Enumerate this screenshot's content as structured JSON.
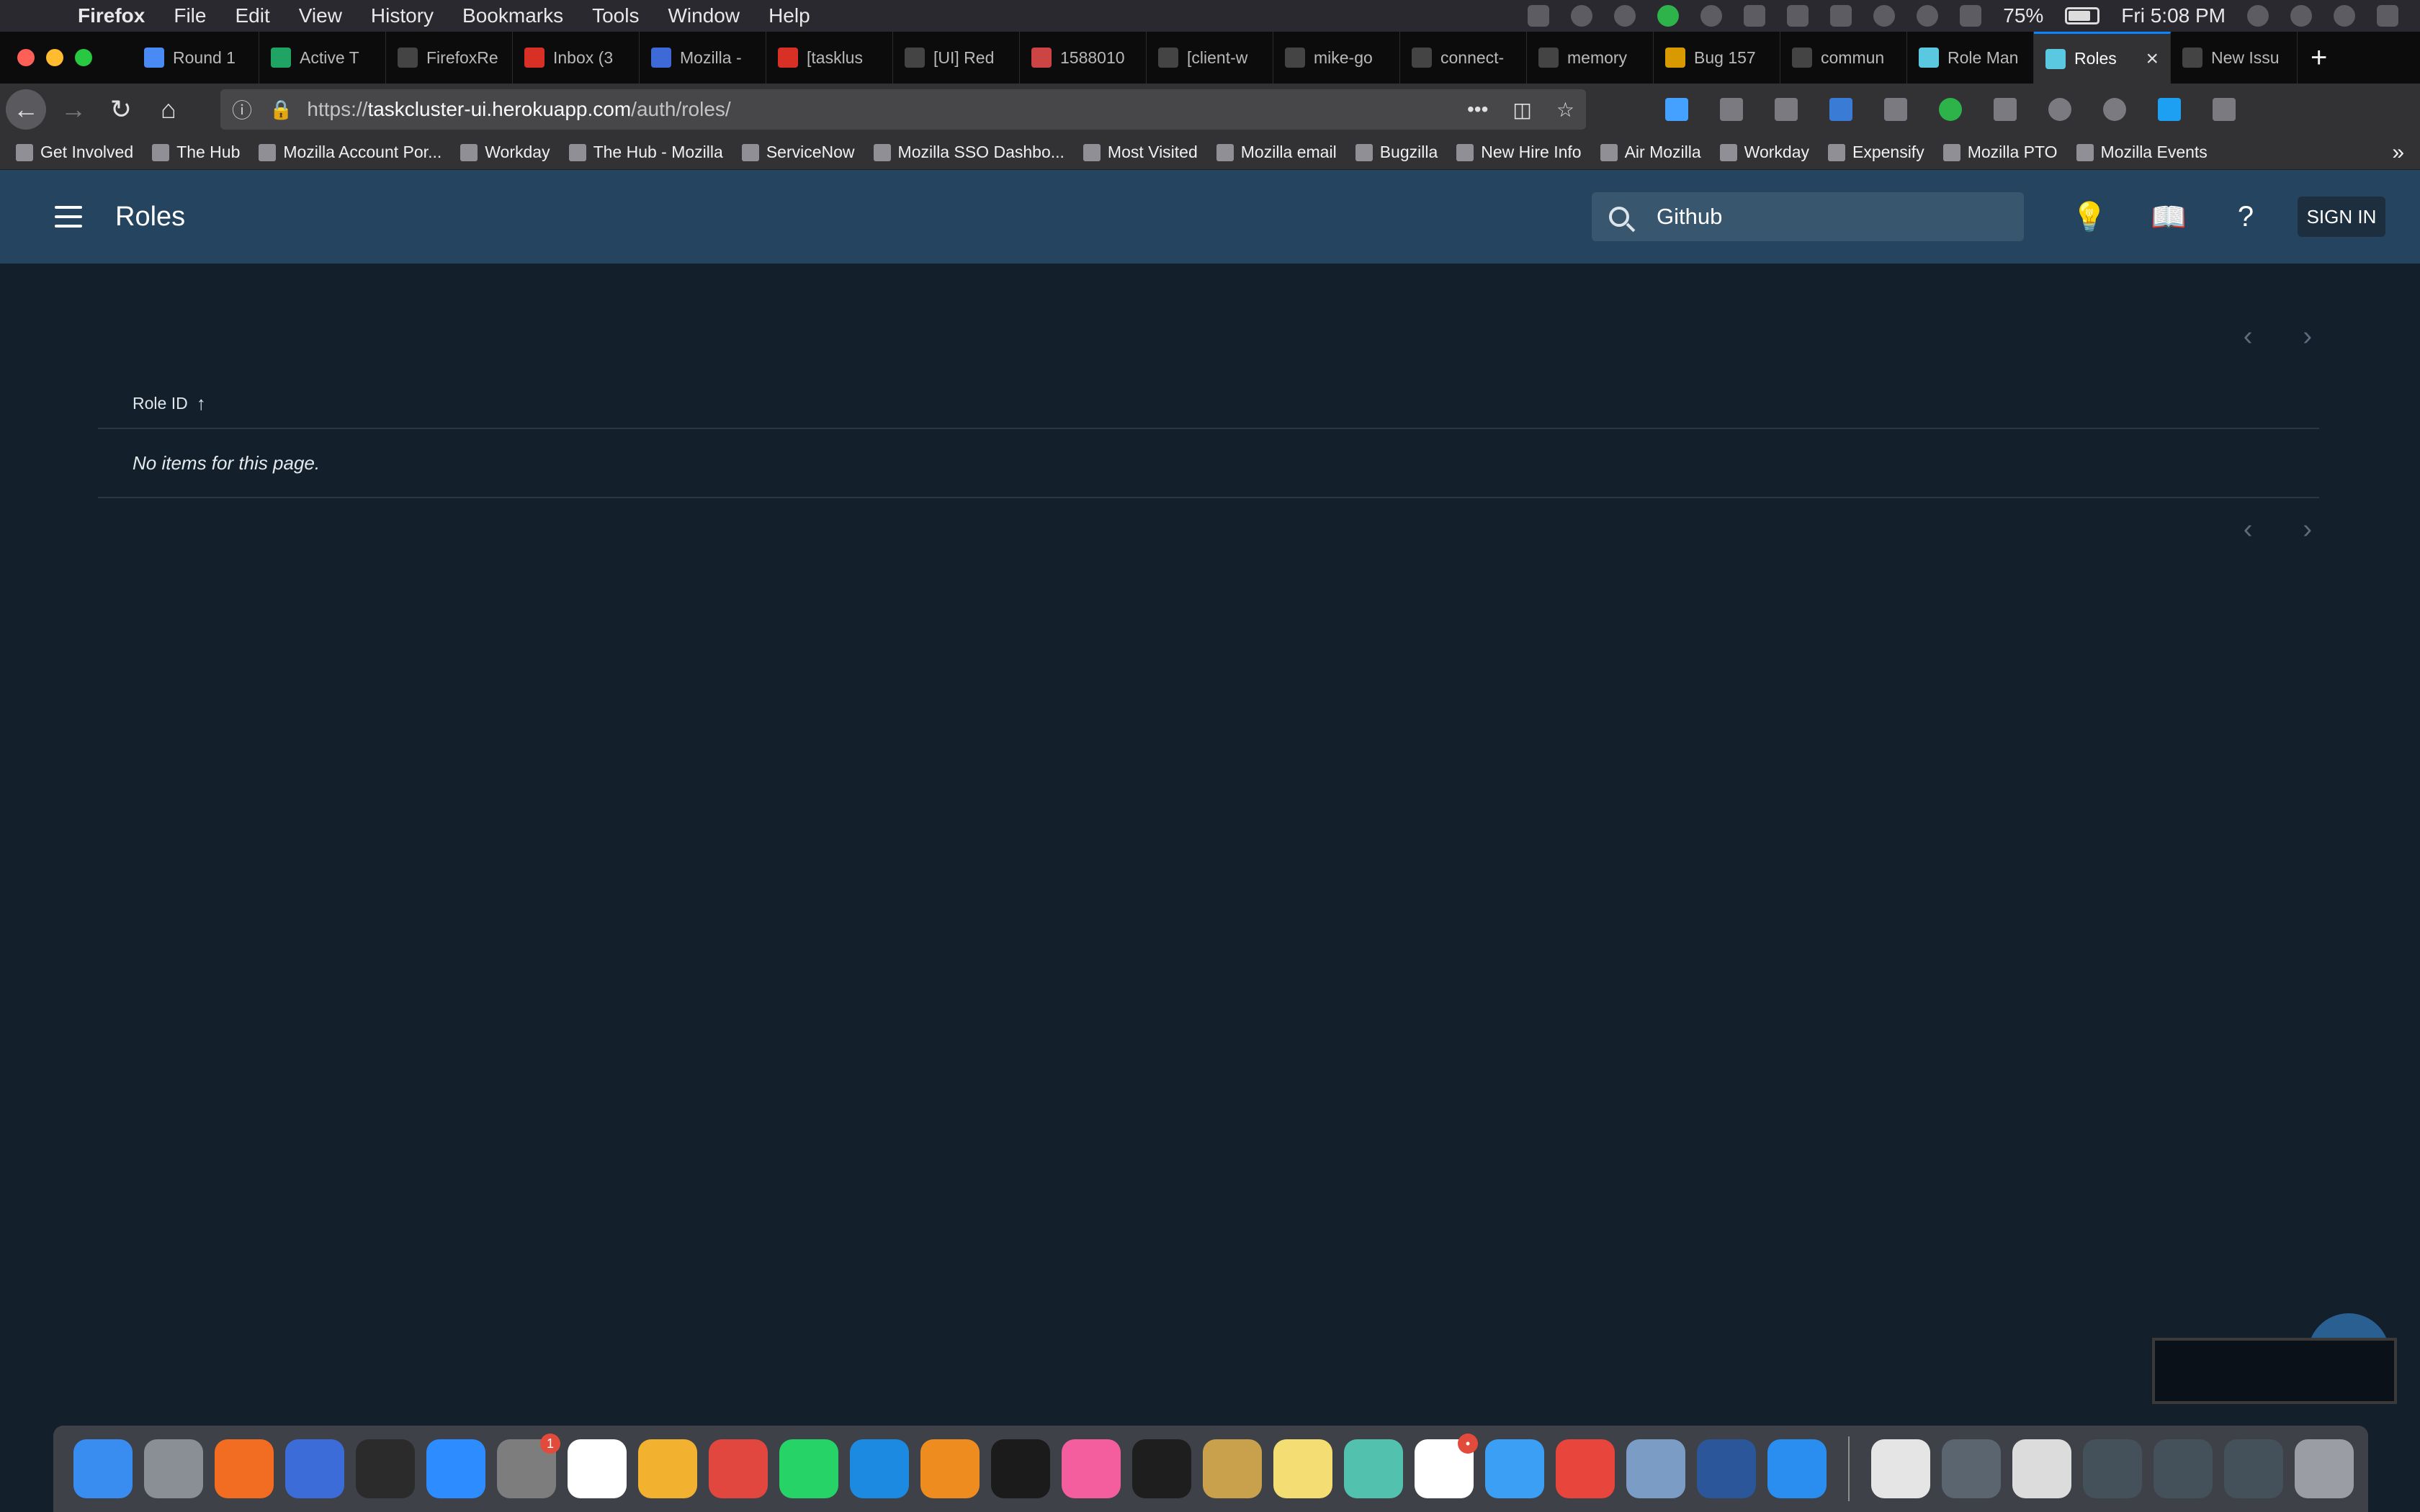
{
  "menubar": {
    "app_name": "Firefox",
    "menus": [
      "File",
      "Edit",
      "View",
      "History",
      "Bookmarks",
      "Tools",
      "Window",
      "Help"
    ],
    "battery": "75%",
    "clock": "Fri 5:08 PM"
  },
  "tabs": [
    {
      "title": "Round 1",
      "color": "#4a8af4"
    },
    {
      "title": "Active T",
      "color": "#1fa463"
    },
    {
      "title": "FirefoxRe",
      "color": "#444"
    },
    {
      "title": "Inbox (3",
      "color": "#d93025"
    },
    {
      "title": "Mozilla -",
      "color": "#3d6ad6"
    },
    {
      "title": "[tasklus",
      "color": "#d93025"
    },
    {
      "title": "[UI] Red",
      "color": "#444"
    },
    {
      "title": "1588010",
      "color": "#c44"
    },
    {
      "title": "[client-w",
      "color": "#444"
    },
    {
      "title": "mike-go",
      "color": "#444"
    },
    {
      "title": "connect-",
      "color": "#444"
    },
    {
      "title": "memory",
      "color": "#444"
    },
    {
      "title": "Bug 157",
      "color": "#d99a00"
    },
    {
      "title": "commun",
      "color": "#444"
    },
    {
      "title": "Role Man",
      "color": "#5ac8e0"
    },
    {
      "title": "Roles",
      "color": "#5ac8e0",
      "active": true
    },
    {
      "title": "New Issu",
      "color": "#444"
    }
  ],
  "navbar": {
    "url_prefix": "https://",
    "url_host": "taskcluster-ui.herokuapp.com",
    "url_path": "/auth/roles/"
  },
  "bookmarks": [
    "Get Involved",
    "The Hub",
    "Mozilla Account Por...",
    "Workday",
    "The Hub - Mozilla",
    "ServiceNow",
    "Mozilla SSO Dashbo...",
    "Most Visited",
    "Mozilla email",
    "Bugzilla",
    "New Hire Info",
    "Air Mozilla",
    "Workday",
    "Expensify",
    "Mozilla PTO",
    "Mozilla Events"
  ],
  "header": {
    "title": "Roles",
    "search_value": "Github",
    "signin_label": "SIGN IN"
  },
  "table": {
    "column_header": "Role ID",
    "empty_message": "No items for this page."
  },
  "dock": {
    "apps": [
      {
        "name": "finder",
        "color": "#3a8df0"
      },
      {
        "name": "launchpad",
        "color": "#8a8f96"
      },
      {
        "name": "firefox",
        "color": "#f26d21"
      },
      {
        "name": "firefox-nightly",
        "color": "#3c6cd8"
      },
      {
        "name": "app-dark",
        "color": "#2b2b2b"
      },
      {
        "name": "zoom",
        "color": "#2d8cff"
      },
      {
        "name": "system-preferences",
        "color": "#7d7d7d",
        "badge": "1"
      },
      {
        "name": "evernote",
        "color": "#ffffff"
      },
      {
        "name": "chrome-canary",
        "color": "#f2b230"
      },
      {
        "name": "wunderlist",
        "color": "#e1473f"
      },
      {
        "name": "whatsapp",
        "color": "#25d366"
      },
      {
        "name": "vscode",
        "color": "#1c8ae0"
      },
      {
        "name": "sublime",
        "color": "#ef8c1f"
      },
      {
        "name": "webstorm",
        "color": "#1b1b1b"
      },
      {
        "name": "itunes",
        "color": "#f45e9f"
      },
      {
        "name": "terminal",
        "color": "#1e1e1e"
      },
      {
        "name": "keychain",
        "color": "#c9a04c"
      },
      {
        "name": "stickies",
        "color": "#f4dd73"
      },
      {
        "name": "zulip",
        "color": "#52c2af"
      },
      {
        "name": "slack",
        "color": "#ffffff",
        "badge": "•"
      },
      {
        "name": "messages",
        "color": "#3ba0f5"
      },
      {
        "name": "chrome",
        "color": "#e8453c"
      },
      {
        "name": "preview",
        "color": "#7b9cc4"
      },
      {
        "name": "word",
        "color": "#2b579a"
      },
      {
        "name": "safari",
        "color": "#2a8df0"
      },
      {
        "name": "document",
        "color": "#e5e5e5"
      },
      {
        "name": "window-thumb",
        "color": "#5a6570"
      },
      {
        "name": "window-thumb",
        "color": "#dcdcdc"
      },
      {
        "name": "window-thumb",
        "color": "#44505a"
      },
      {
        "name": "window-thumb",
        "color": "#44505a"
      },
      {
        "name": "window-thumb",
        "color": "#44505a"
      },
      {
        "name": "trash",
        "color": "#9a9ea4"
      }
    ]
  }
}
